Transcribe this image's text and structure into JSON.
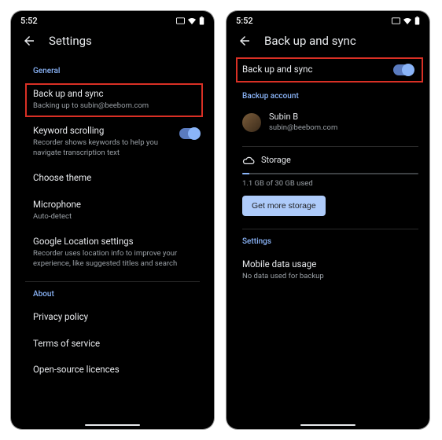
{
  "status": {
    "time": "5:52"
  },
  "left": {
    "title": "Settings",
    "sections": {
      "general_label": "General",
      "about_label": "About"
    },
    "items": {
      "backup": {
        "title": "Back up and sync",
        "sub": "Backing up to subin@beebom.com"
      },
      "keyword": {
        "title": "Keyword scrolling",
        "sub": "Recorder shows keywords to help you navigate transcription text"
      },
      "theme": {
        "title": "Choose theme"
      },
      "mic": {
        "title": "Microphone",
        "sub": "Auto-detect"
      },
      "location": {
        "title": "Google Location settings",
        "sub": "Recorder uses location info to improve your experience, like suggested titles and search"
      },
      "privacy": {
        "title": "Privacy policy"
      },
      "tos": {
        "title": "Terms of service"
      },
      "oss": {
        "title": "Open-source licences"
      }
    }
  },
  "right": {
    "title": "Back up and sync",
    "sync_toggle_label": "Back up and sync",
    "sections": {
      "account_label": "Backup account",
      "settings_label": "Settings"
    },
    "account": {
      "name": "Subin B",
      "email": "subin@beebom.com"
    },
    "storage": {
      "label": "Storage",
      "used": "1.1 GB of 30 GB used",
      "button": "Get more storage"
    },
    "mobile_data": {
      "title": "Mobile data usage",
      "sub": "No data used for backup"
    }
  },
  "colors": {
    "accent": "#8ab4f8",
    "highlight": "#d93025"
  }
}
